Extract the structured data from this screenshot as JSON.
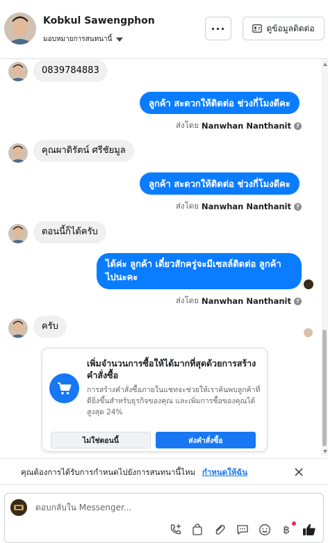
{
  "header": {
    "contact_name": "Kobkul Sawengphon",
    "assign_label": "มอบหมายการสนทนานี้",
    "more_label": "···",
    "contact_info_label": "ดูข้อมูลติดต่อ"
  },
  "messages": {
    "m1": "0839784883",
    "m2": "ลูกค้า สะดวกให้ติดต่อ ช่วงกี่โมงดีคะ",
    "m3": "คุณผาดิรัตน์ ศรีชัยมูล",
    "m4": "ลูกค้า สะดวกให้ติดต่อ ช่วงกี่โมงดีคะ",
    "m5": "ตอนนี้ก็ได้ครับ",
    "m6_line1": "ได้ค่ะ ลูกค้า เดี๋ยวสักครู่จะมีเซลล์ติดต่อ ลูกค้า",
    "m6_line2": "ไปนะคะ",
    "m7": "ครับ"
  },
  "sent_by": {
    "prefix": "ส่งโดย",
    "agent": "Nanwhan Nanthanit"
  },
  "order_card": {
    "title": "เพิ่มจำนวนการซื้อให้ได้มากที่สุดด้วยการสร้างคำสั่งซื้อ",
    "body": "การสร้างคำสั่งซื้อภายในแชทจะช่วยให้เราค้นพบลูกค้าที่ดียิ่งขึ้นสำหรับธุรกิจของคุณ และเพิ่มการซื้อของคุณได้สูงสุด 24%",
    "not_now_label": "ไม่ใช่ตอนนี้",
    "send_order_label": "ส่งคำสั่งซื้อ"
  },
  "assign_banner": {
    "text": "คุณต้องการได้รับการกำหนดไปยังการสนทนานี้ไหม",
    "link": "กำหนดให้ฉัน"
  },
  "composer": {
    "placeholder": "ตอบกลับใน Messenger..."
  },
  "colors": {
    "outgoing_bubble": "#0a7cff",
    "incoming_bubble": "#f0f0f0",
    "accent": "#1877f2",
    "notification_dot": "#f02849"
  },
  "icons": [
    "more-icon",
    "contact-card-icon",
    "cart-icon",
    "close-icon",
    "call-add-icon",
    "shopping-bag-icon",
    "paperclip-icon",
    "saved-reply-icon",
    "emoji-icon",
    "baht-icon",
    "like-icon",
    "info-icon"
  ]
}
